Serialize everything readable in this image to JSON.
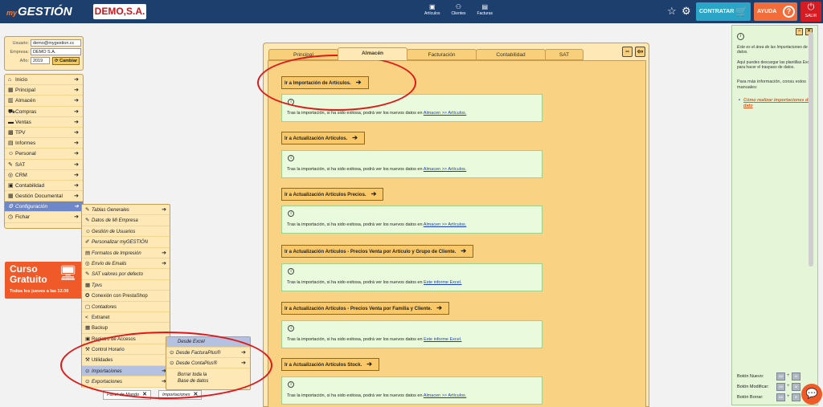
{
  "topbar": {
    "logo_prefix": "my",
    "logo_name": "GESTIÓN",
    "company": "DEMO,S.A.",
    "nav": [
      {
        "label": "Artículos",
        "icon": "box-icon"
      },
      {
        "label": "Clientes",
        "icon": "people-icon"
      },
      {
        "label": "Facturas",
        "icon": "invoice-icon"
      }
    ],
    "contratar": "CONTRATAR",
    "ayuda": "AYUDA",
    "salir": "SALIR"
  },
  "user": {
    "usuario_label": "Usuario:",
    "usuario": "demo@mygestion.cc",
    "empresa_label": "Empresa:",
    "empresa": "DEMO S.A.",
    "anio_label": "Año:",
    "anio": "2019",
    "cambiar": "Cambiar"
  },
  "main_menu": [
    {
      "label": "Inicio",
      "icon": "home-icon"
    },
    {
      "label": "Principal",
      "icon": "building-icon"
    },
    {
      "label": "Almacén",
      "icon": "warehouse-icon"
    },
    {
      "label": "Compras",
      "icon": "truck-icon"
    },
    {
      "label": "Ventas",
      "icon": "sales-icon"
    },
    {
      "label": "TPV",
      "icon": "register-icon"
    },
    {
      "label": "Informes",
      "icon": "report-icon"
    },
    {
      "label": "Personal",
      "icon": "person-icon"
    },
    {
      "label": "SAT",
      "icon": "wrench-icon"
    },
    {
      "label": "CRM",
      "icon": "crm-icon"
    },
    {
      "label": "Contabilidad",
      "icon": "ledger-icon"
    },
    {
      "label": "Gestión Documental",
      "icon": "documents-icon"
    },
    {
      "label": "Configuración",
      "icon": "gear-icon"
    },
    {
      "label": "Fichar",
      "icon": "clock-icon"
    }
  ],
  "sub_menu": [
    {
      "label": "Tablas Generales",
      "icon": "tables-icon"
    },
    {
      "label": "Datos de Mi Empresa",
      "icon": "company-data-icon"
    },
    {
      "label": "Gestión de Usuarios",
      "icon": "users-icon"
    },
    {
      "label": "Personalizar myGESTIÓN",
      "icon": "brush-icon"
    },
    {
      "label": "Formatos de Impresión",
      "icon": "print-format-icon"
    },
    {
      "label": "Envío de Emails",
      "icon": "email-icon"
    },
    {
      "label": "SAT valores por defecto",
      "icon": "wrench-icon"
    },
    {
      "label": "Tpvs",
      "icon": "register-icon"
    },
    {
      "label": "Conexión con PrestaShop",
      "icon": "prestashop-icon"
    },
    {
      "label": "Contadores",
      "icon": "counter-icon"
    },
    {
      "label": "Extranet",
      "icon": "extranet-icon"
    },
    {
      "label": "Backup",
      "icon": "backup-icon"
    },
    {
      "label": "Registro de Accesos",
      "icon": "access-log-icon"
    },
    {
      "label": "Control Horario",
      "icon": "time-control-icon"
    },
    {
      "label": "Utilidades",
      "icon": "utilities-icon"
    },
    {
      "label": "Importaciones",
      "icon": "import-icon"
    },
    {
      "label": "Exportaciones",
      "icon": "export-icon"
    }
  ],
  "third_menu": [
    {
      "label": "Desde Excel"
    },
    {
      "label": "Desde FacturaPlus®",
      "icon": "facturaplus-icon"
    },
    {
      "label": "Desde ContaPlus®",
      "icon": "contaplus-icon"
    },
    {
      "label": "Borrar toda la Base de datos"
    }
  ],
  "bottom_tabs": [
    "Panel de Mando",
    "Importaciones"
  ],
  "promo": {
    "line1": "Curso",
    "line2": "Gratuito",
    "line3": "Todos los jueves a las 12.00"
  },
  "panel": {
    "tabs": [
      "Principal",
      "Almacén",
      "Facturación",
      "Contabilidad",
      "SAT"
    ],
    "sections": [
      {
        "button": "Ir a Importación de Artículos.",
        "msg": "Tras la importación, si ha sido exitosa, podrá ver los nuevos datos en",
        "link": "Almacen >> Artículos."
      },
      {
        "button": "Ir a Actualización Artículos.",
        "msg": "Tras la importación, si ha sido exitosa, podrá ver los nuevos datos en",
        "link": "Almacen >> Artículos."
      },
      {
        "button": "Ir a Actualización Artículos Precios.",
        "msg": "Tras la importación, si ha sido exitosa, podrá ver los nuevos datos en",
        "link": "Almacen >> Artículos."
      },
      {
        "button": "Ir a Actualización Artículos - Precios Venta por Artículo y Grupo de Cliente.",
        "msg": "Tras la importación, si ha sido exitosa, podrá ver los nuevos datos en",
        "link": "Este informe Excel."
      },
      {
        "button": "Ir a Actualización Artículos - Precios Venta por Familia y Cliente.",
        "msg": "Tras la importación, si ha sido exitosa, podrá ver los nuevos datos en",
        "link": "Este informe Excel."
      },
      {
        "button": "Ir a Actualización Artículos Stock.",
        "msg": "Tras la importación, si ha sido exitosa, podrá ver los nuevos datos en",
        "link": "Almacen >> Artículos."
      }
    ]
  },
  "help": {
    "p1": "Este es el área de las Importaciones de datos.",
    "p2": "Aquí puedes descargar las plantillas Excel para hacer el traspaso de datos.",
    "p3": "Para más información, consu estos manuales:",
    "link": "Cómo realizar importaciones de dato",
    "nuevo": "Botón Nuevo:",
    "modificar": "Botón Modificar:",
    "borrar": "Botón Borrar:",
    "key_alt": "Alt",
    "key_n": "N",
    "key_m": "M",
    "key_b": "B"
  }
}
